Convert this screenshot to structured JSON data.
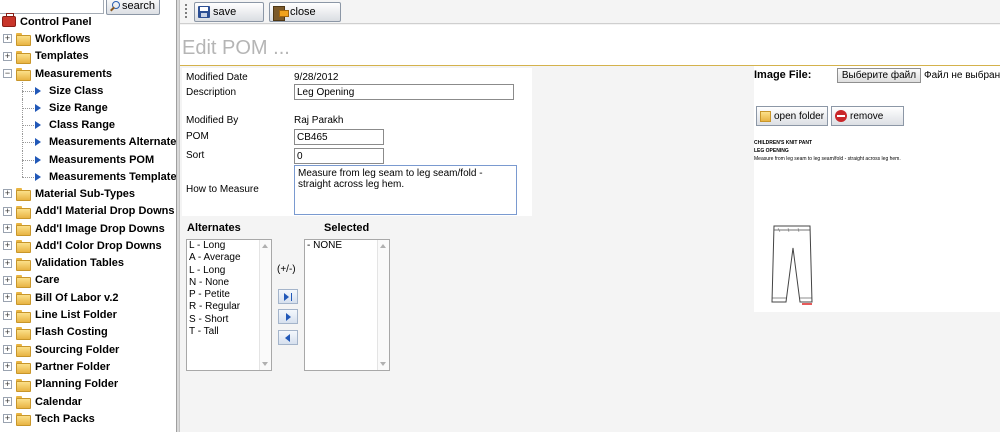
{
  "search": {
    "value": "",
    "button_label": "search"
  },
  "tree": {
    "root": "Control Panel",
    "items": [
      {
        "label": "Workflows",
        "expander": "+"
      },
      {
        "label": "Templates",
        "expander": "+"
      },
      {
        "label": "Measurements",
        "expander": "−"
      }
    ],
    "measurement_children": [
      "Size Class",
      "Size Range",
      "Class Range",
      "Measurements Alternates",
      "Measurements POM",
      "Measurements Templates"
    ],
    "items_after": [
      "Material Sub-Types",
      "Add'l Material Drop Downs",
      "Add'l Image Drop Downs",
      "Add'l Color Drop Downs",
      "Validation Tables",
      "Care",
      "Bill Of Labor v.2",
      "Line List Folder",
      "Flash Costing",
      "Sourcing Folder",
      "Partner Folder",
      "Planning Folder",
      "Calendar",
      "Tech Packs"
    ]
  },
  "toolbar": {
    "save_label": "save",
    "close_label": "close"
  },
  "page_title": "Edit POM ...",
  "form": {
    "modified_date_label": "Modified Date",
    "modified_date": "9/28/2012",
    "description_label": "Description",
    "description": "Leg Opening",
    "modified_by_label": "Modified By",
    "modified_by": "Raj Parakh",
    "pom_label": "POM",
    "pom": "CB465",
    "sort_label": "Sort",
    "sort": "0",
    "how_to_measure_label": "How to Measure",
    "how_to_measure": "Measure from leg seam to leg seam/fold - straight across leg hem."
  },
  "alternates": {
    "heading": "Alternates",
    "items": [
      "L - Long",
      "A - Average",
      "L - Long",
      "N - None",
      "P - Petite",
      "R - Regular",
      "S - Short",
      "T - Tall"
    ]
  },
  "selected": {
    "heading": "Selected",
    "items": [
      "- NONE"
    ]
  },
  "plus_minus": "(+/-)",
  "image": {
    "label": "Image File:",
    "choose_button": "Выберите файл",
    "no_file": "Файл не выбран",
    "open_folder": "open folder",
    "remove": "remove",
    "sketch_title": "CHILDREN'S KNIT PANT",
    "sketch_subtitle": "LEG OPENING",
    "sketch_text": "Measure from leg seam to leg seam/fold - straight across leg hem."
  }
}
